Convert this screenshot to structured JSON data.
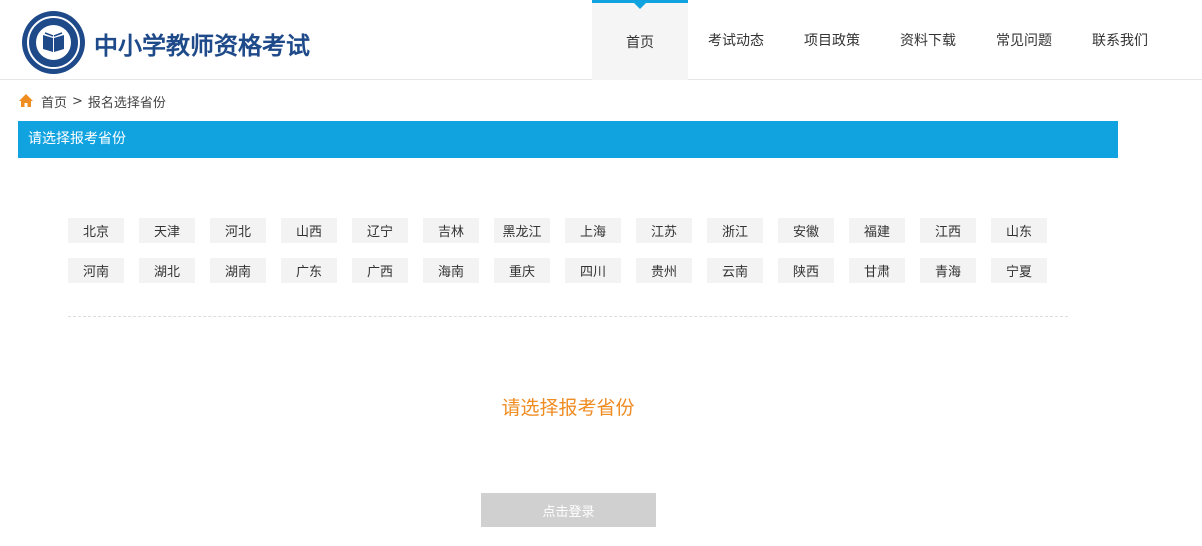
{
  "site": {
    "title": "中小学教师资格考试"
  },
  "nav": {
    "items": [
      {
        "label": "首页",
        "active": true
      },
      {
        "label": "考试动态"
      },
      {
        "label": "项目政策"
      },
      {
        "label": "资料下载"
      },
      {
        "label": "常见问题"
      },
      {
        "label": "联系我们"
      }
    ]
  },
  "breadcrumb": {
    "home": "首页",
    "separator": ">",
    "current": "报名选择省份"
  },
  "section": {
    "title": "请选择报考省份"
  },
  "provinces": {
    "row1": [
      "北京",
      "天津",
      "河北",
      "山西",
      "辽宁",
      "吉林",
      "黑龙江",
      "上海",
      "江苏",
      "浙江",
      "安徽",
      "福建",
      "江西",
      "山东"
    ],
    "row2": [
      "河南",
      "湖北",
      "湖南",
      "广东",
      "广西",
      "海南",
      "重庆",
      "四川",
      "贵州",
      "云南",
      "陕西",
      "甘肃",
      "青海",
      "宁夏"
    ]
  },
  "prompt": "请选择报考省份",
  "login_button": "点击登录",
  "colors": {
    "accent": "#11a3e0",
    "brand": "#1f4a8a",
    "prompt": "#ef8c22",
    "home_icon": "#ef8c22"
  }
}
